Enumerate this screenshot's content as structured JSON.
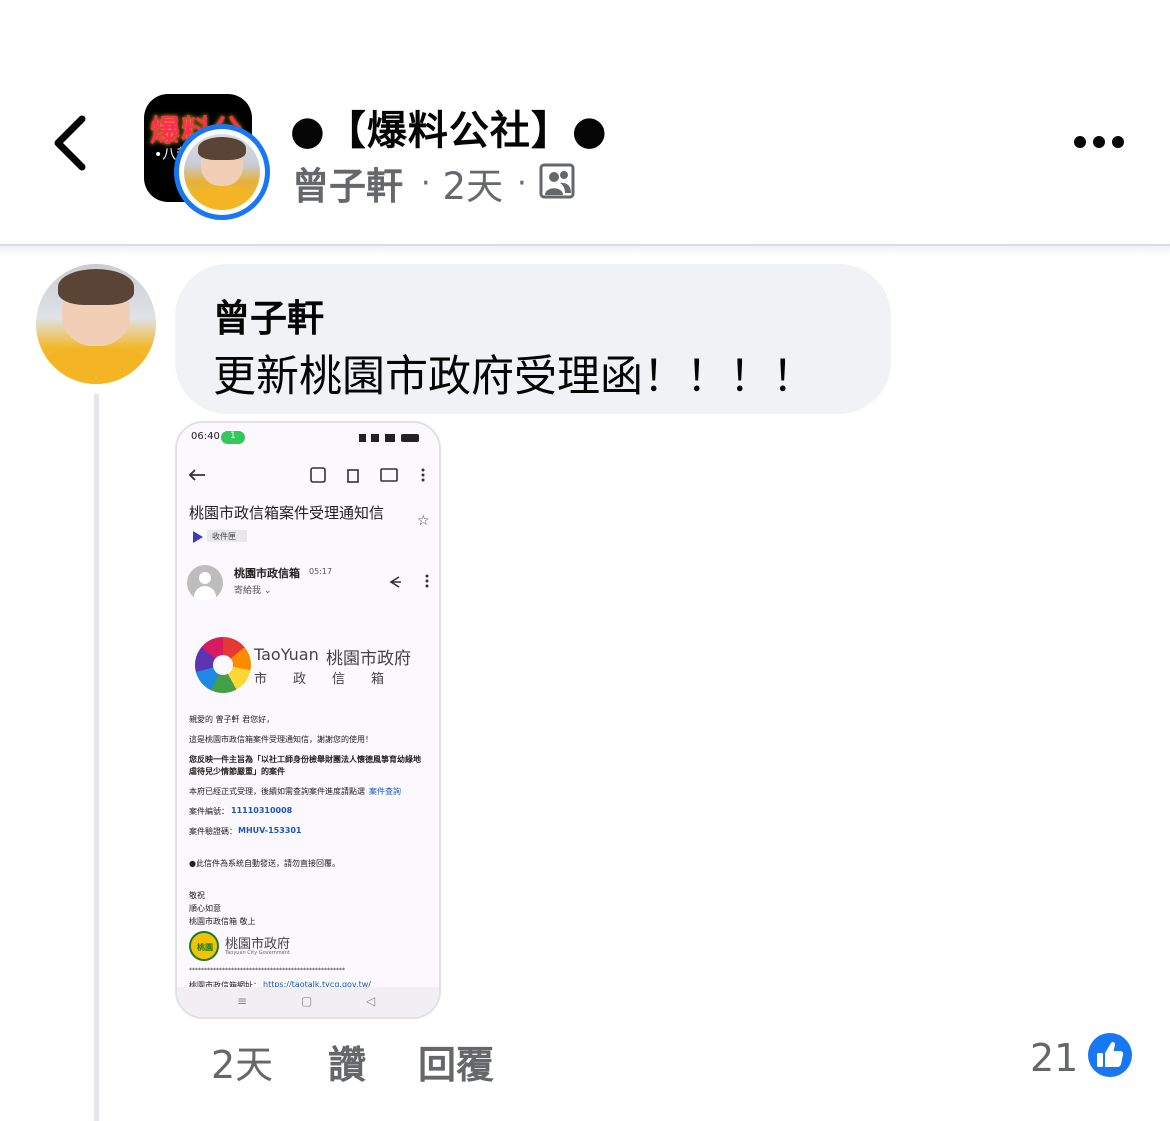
{
  "header": {
    "group_name": "●【爆料公社】●",
    "group_logo_text": "爆料公",
    "group_logo_sub": "•八卦",
    "author": "曾子軒",
    "separator": "·",
    "time": "2天",
    "audience_icon": "group-members-icon",
    "accent_color": "#1877f2"
  },
  "comment": {
    "author": "曾子軒",
    "text": "更新桃園市政府受理函！！！！",
    "actions": {
      "time": "2天",
      "like": "讚",
      "reply": "回覆"
    },
    "reaction_count": "21",
    "reaction_icon": "like-thumb-icon"
  },
  "attachment": {
    "status_time": "06:40",
    "status_pill": "1",
    "subject": "桃園市政信箱案件受理通知信",
    "label": "收件匣",
    "sender": "桃園市政信箱",
    "sent_time": "05:17",
    "recipient": "寄給我 ⌄",
    "logo_text_en": "TaoYuan",
    "logo_text_zh": "桃園市政府",
    "logo_sub": "市　　政　　信　　箱",
    "greeting": "親愛的 曾子軒 君您好，",
    "line1": "這是桃園市政信箱案件受理通知信，謝謝您的使用！",
    "line2a": "您反映一件主旨為「以社工師身份檢舉財團法人懷德風箏育幼綠地",
    "line2b": "虐待兒少情節嚴重」的案件",
    "line3": "本府已經正式受理，後續如需查詢案件進度請點選",
    "line3_link": "案件查詢",
    "case_no_label": "案件編號：",
    "case_no": "11110310008",
    "verify_label": "案件驗證碼：",
    "verify_code": "MHUV-153301",
    "auto_notice": "●此信件為系統自動發送，請勿直接回覆。",
    "closing1": "敬祝",
    "closing2": "順心如意",
    "closing3": "桃園市政信箱 敬上",
    "seal_text": "桃園",
    "footer_logo_zh": "桃園市政府",
    "footer_logo_en": "Taoyuan City Government",
    "stars": "****************************************************",
    "url_label": "桃園市政信箱網址：",
    "url": "https://taotalk.tycg.gov.tw/",
    "nav_icons": [
      "≡",
      "▢",
      "◁"
    ]
  }
}
